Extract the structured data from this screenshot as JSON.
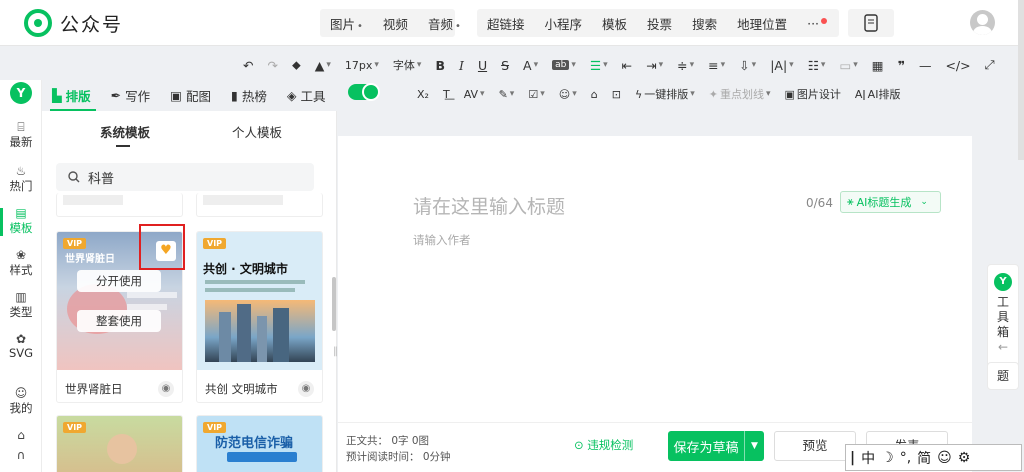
{
  "app": {
    "name": "公众号",
    "brand_color": "#07c160"
  },
  "top_menu": {
    "group1": [
      {
        "label": "图片",
        "has_dropdown": true
      },
      {
        "label": "视频",
        "has_dropdown": false
      },
      {
        "label": "音频",
        "has_dropdown": true
      }
    ],
    "group2": [
      {
        "label": "超链接"
      },
      {
        "label": "小程序"
      },
      {
        "label": "模板"
      },
      {
        "label": "投票"
      },
      {
        "label": "搜索"
      },
      {
        "label": "地理位置"
      },
      {
        "label": "···"
      }
    ]
  },
  "format_toolbar": {
    "font_size": "17px",
    "font_label": "字体",
    "ai_layout_label": "一键排版",
    "highlight_label": "重点划线",
    "image_design_label": "图片设计",
    "ai_typeset_label": "AI排版"
  },
  "rail": {
    "items": [
      {
        "label": "最新",
        "icon": "message-icon"
      },
      {
        "label": "热门",
        "icon": "fire-icon"
      },
      {
        "label": "模板",
        "icon": "template-icon",
        "active": true
      },
      {
        "label": "样式",
        "icon": "style-icon"
      },
      {
        "label": "类型",
        "icon": "type-icon"
      },
      {
        "label": "SVG",
        "icon": "svg-icon"
      },
      {
        "label": "我的",
        "icon": "user-icon"
      }
    ]
  },
  "plugin_tabs": [
    {
      "label": "排版",
      "icon": "layout-icon",
      "active": true
    },
    {
      "label": "写作",
      "icon": "pen-icon"
    },
    {
      "label": "配图",
      "icon": "image-icon"
    },
    {
      "label": "热榜",
      "icon": "bookmark-icon"
    },
    {
      "label": "工具",
      "icon": "cube-icon"
    }
  ],
  "template_panel": {
    "subtabs": [
      "系统模板",
      "个人模板"
    ],
    "search_value": "科普",
    "cards": [
      {
        "title": "世界肾脏日",
        "vip": "VIP",
        "hover_buttons": [
          "分开使用",
          "整套使用"
        ]
      },
      {
        "title": "共创 文明城市",
        "vip": "VIP",
        "headline": "共创 · 文明城市"
      },
      {
        "title": "",
        "vip": "VIP"
      },
      {
        "title": "",
        "vip": "VIP",
        "headline": "防范电信诈骗"
      }
    ]
  },
  "editor": {
    "title_placeholder": "请在这里输入标题",
    "title_count": "0/64",
    "ai_title_button": "AI标题生成",
    "author_placeholder": "请输入作者"
  },
  "bottom_bar": {
    "body_stats": "正文共：   0字 0图",
    "read_time": "预计阅读时间：   0分钟",
    "violation_check": "违规检测",
    "save_draft": "保存为草稿",
    "preview": "预览",
    "send": "发表"
  },
  "right_toolbox": {
    "chars": [
      "工",
      "具",
      "箱"
    ],
    "second": "题"
  },
  "ime_bar": [
    "中",
    "☽",
    "°,",
    "简",
    "☺",
    "⚙"
  ]
}
